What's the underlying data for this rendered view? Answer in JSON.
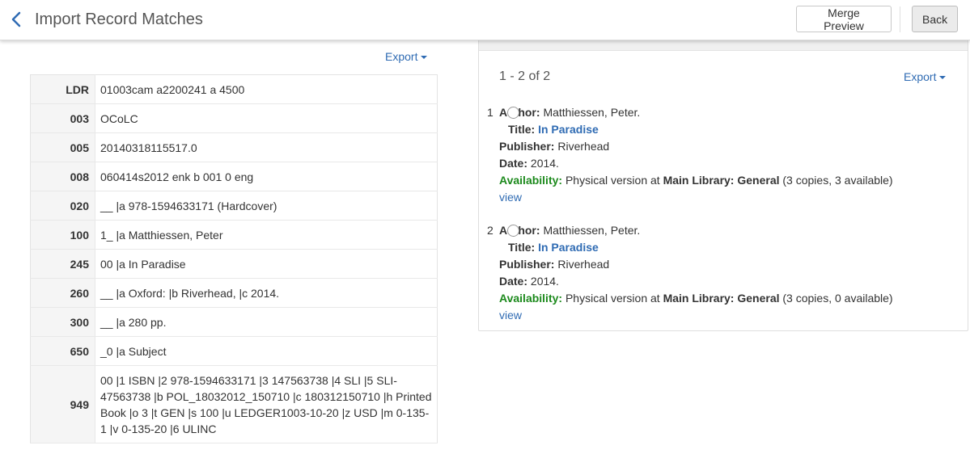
{
  "header": {
    "title": "Import Record Matches",
    "merge_preview_label": "Merge Preview",
    "back_label": "Back"
  },
  "left": {
    "export_label": "Export",
    "marc_rows": [
      {
        "tag": "LDR",
        "value": "01003cam a2200241 a 4500"
      },
      {
        "tag": "003",
        "value": "OCoLC"
      },
      {
        "tag": "005",
        "value": "20140318115517.0"
      },
      {
        "tag": "008",
        "value": "060414s2012 enk b 001 0 eng"
      },
      {
        "tag": "020",
        "value": "__ |a 978-1594633171 (Hardcover)"
      },
      {
        "tag": "100",
        "value": "1_ |a Matthiessen, Peter"
      },
      {
        "tag": "245",
        "value": "00 |a In Paradise"
      },
      {
        "tag": "260",
        "value": "__ |a Oxford: |b Riverhead, |c 2014."
      },
      {
        "tag": "300",
        "value": "__ |a 280 pp."
      },
      {
        "tag": "650",
        "value": "_0 |a Subject"
      },
      {
        "tag": "949",
        "value": "00 |1 ISBN |2 978-1594633171 |3 147563738 |4 SLI |5 SLI-47563738 |b POL_18032012_150710 |c 180312150710 |h Printed Book |o 3 |t GEN |s 100 |u LEDGER1003-10-20 |z USD |m 0-135-1 |v 0-135-20 |6 ULINC"
      }
    ]
  },
  "right": {
    "count_text": "1 - 2 of 2",
    "export_label": "Export",
    "results": [
      {
        "number": "1",
        "author_label": "Author:",
        "author": "Matthiessen, Peter.",
        "title_label": "Title:",
        "title": "In Paradise",
        "publisher_label": "Publisher:",
        "publisher": "Riverhead",
        "date_label": "Date:",
        "date": "2014.",
        "availability_label": "Availability:",
        "availability_prefix": "Physical version at",
        "library": "Main Library: General",
        "copies": "(3 copies, 3 available)",
        "view_label": "view"
      },
      {
        "number": "2",
        "author_label": "Author:",
        "author": "Matthiessen, Peter.",
        "title_label": "Title:",
        "title": "In Paradise",
        "publisher_label": "Publisher:",
        "publisher": "Riverhead",
        "date_label": "Date:",
        "date": "2014.",
        "availability_label": "Availability:",
        "availability_prefix": "Physical version at",
        "library": "Main Library: General",
        "copies": "(3 copies, 0 available)",
        "view_label": "view"
      }
    ]
  },
  "colors": {
    "link": "#2f6bb3",
    "availability": "#1d8a1d",
    "tag_background": "#f5f5f5"
  }
}
